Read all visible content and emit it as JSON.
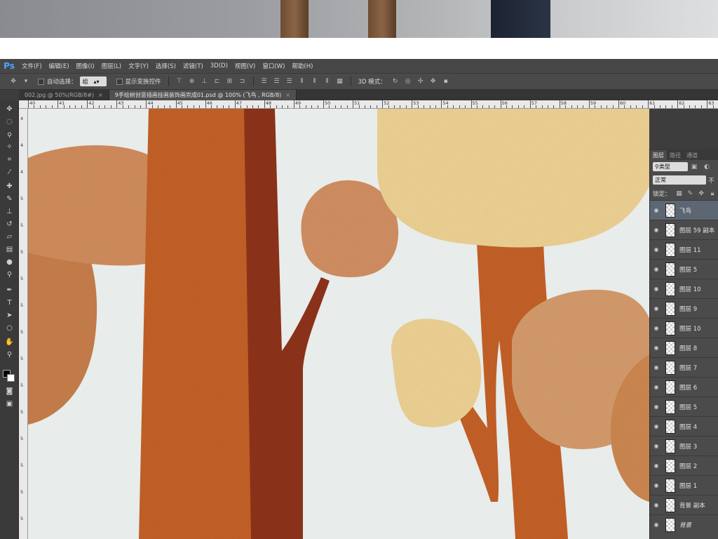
{
  "app": {
    "logo": "Ps",
    "menu": [
      "文件(F)",
      "编辑(E)",
      "图像(I)",
      "图层(L)",
      "文字(Y)",
      "选择(S)",
      "滤镜(T)",
      "3D(D)",
      "视图(V)",
      "窗口(W)",
      "帮助(H)"
    ]
  },
  "options_bar": {
    "auto_select_label": "自动选择：",
    "auto_select_value": "组",
    "show_transform_label": "显示变换控件",
    "mode_3d_label": "3D 模式："
  },
  "tabs": [
    {
      "label": "002.jpg @ 50%(RGB/8#)",
      "active": false
    },
    {
      "label": "9手绘树创意插画挂画装饰画完成01.psd @ 100% (飞鸟 , RGB/8)",
      "active": true
    }
  ],
  "ruler": {
    "h_labels": [
      "40",
      "41",
      "42",
      "43",
      "44",
      "45",
      "46",
      "47",
      "48",
      "49",
      "50",
      "51",
      "52",
      "53",
      "54",
      "55",
      "56",
      "57",
      "58",
      "59",
      "60",
      "61",
      "62",
      "63"
    ],
    "v_labels": [
      "4",
      "4",
      "4",
      "5",
      "5",
      "5",
      "5",
      "5",
      "5",
      "5",
      "5",
      "5",
      "5",
      "5",
      "5",
      "5"
    ]
  },
  "layers_panel": {
    "tabs": [
      "图层",
      "路径",
      "通道"
    ],
    "filter_label": "类型",
    "blend_mode": "正常",
    "opacity_label": "不",
    "lock_label": "锁定：",
    "layers": [
      {
        "name": "飞鸟",
        "selected": true
      },
      {
        "name": "图层 59 副本",
        "selected": false
      },
      {
        "name": "图层 11",
        "selected": false
      },
      {
        "name": "图层 5",
        "selected": false
      },
      {
        "name": "图层 10",
        "selected": false
      },
      {
        "name": "图层 9",
        "selected": false
      },
      {
        "name": "图层 10",
        "selected": false
      },
      {
        "name": "图层 8",
        "selected": false
      },
      {
        "name": "图层 7",
        "selected": false
      },
      {
        "name": "图层 6",
        "selected": false
      },
      {
        "name": "图层 5",
        "selected": false
      },
      {
        "name": "图层 4",
        "selected": false
      },
      {
        "name": "图层 3",
        "selected": false
      },
      {
        "name": "图层 2",
        "selected": false
      },
      {
        "name": "图层 1",
        "selected": false
      },
      {
        "name": "背景 副本",
        "selected": false
      },
      {
        "name": "背景",
        "selected": false
      }
    ]
  },
  "colors": {
    "canvas_bg": "#e8ecea",
    "trunk_orange": "#c05a22",
    "trunk_dark": "#8a3219",
    "leaf_tan": "#cf8c62",
    "leaf_yellow": "#ecd294"
  }
}
